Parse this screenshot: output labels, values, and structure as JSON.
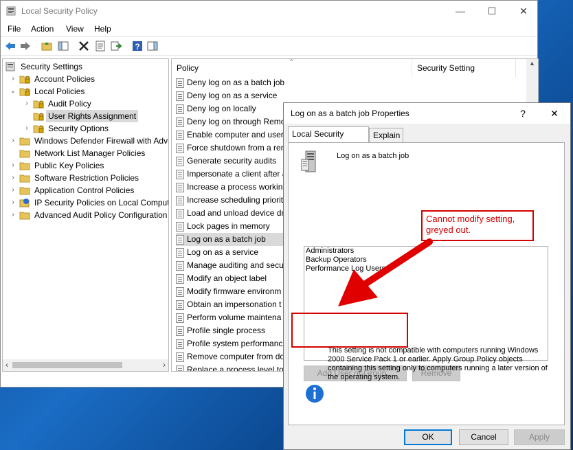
{
  "window": {
    "title": "Local Security Policy",
    "controls": {
      "minimize": "—",
      "maximize": "☐",
      "close": "✕"
    }
  },
  "menu": [
    "File",
    "Action",
    "View",
    "Help"
  ],
  "tree": [
    {
      "label": "Security Settings",
      "level": 0,
      "expander": "",
      "icon": "security-settings-icon"
    },
    {
      "label": "Account Policies",
      "level": 1,
      "expander": "›",
      "icon": "folder-lock-icon"
    },
    {
      "label": "Local Policies",
      "level": 1,
      "expander": "⌄",
      "icon": "folder-lock-icon"
    },
    {
      "label": "Audit Policy",
      "level": 2,
      "expander": "›",
      "icon": "folder-lock-icon"
    },
    {
      "label": "User Rights Assignment",
      "level": 2,
      "expander": "",
      "icon": "folder-lock-icon",
      "selected": true
    },
    {
      "label": "Security Options",
      "level": 2,
      "expander": "›",
      "icon": "folder-lock-icon"
    },
    {
      "label": "Windows Defender Firewall with Adva",
      "level": 1,
      "expander": "›",
      "icon": "folder-icon"
    },
    {
      "label": "Network List Manager Policies",
      "level": 1,
      "expander": "",
      "icon": "folder-icon"
    },
    {
      "label": "Public Key Policies",
      "level": 1,
      "expander": "›",
      "icon": "folder-icon"
    },
    {
      "label": "Software Restriction Policies",
      "level": 1,
      "expander": "›",
      "icon": "folder-icon"
    },
    {
      "label": "Application Control Policies",
      "level": 1,
      "expander": "›",
      "icon": "folder-icon"
    },
    {
      "label": "IP Security Policies on Local Compute",
      "level": 1,
      "expander": "›",
      "icon": "ip-security-icon"
    },
    {
      "label": "Advanced Audit Policy Configuration",
      "level": 1,
      "expander": "›",
      "icon": "folder-icon"
    }
  ],
  "policy_columns": {
    "policy": "Policy",
    "setting": "Security Setting"
  },
  "policies": [
    "Deny log on as a batch job",
    "Deny log on as a service",
    "Deny log on locally",
    "Deny log on through Remo",
    "Enable computer and user",
    "Force shutdown from a ren",
    "Generate security audits",
    "Impersonate a client after a",
    "Increase a process working",
    "Increase scheduling priority",
    "Load and unload device dr",
    "Lock pages in memory",
    "Log on as a batch job",
    "Log on as a service",
    "Manage auditing and secu",
    "Modify an object label",
    "Modify firmware environm",
    "Obtain an impersonation t",
    "Perform volume maintena",
    "Profile single process",
    "Profile system performanc",
    "Remove computer from do",
    "Replace a process level tok"
  ],
  "selected_policy_index": 12,
  "dialog": {
    "title": "Log on as a batch job Properties",
    "help": "?",
    "close": "✕",
    "tabs": [
      "Local Security Setting",
      "Explain"
    ],
    "policy_name": "Log on as a batch job",
    "members": [
      "Administrators",
      "Backup Operators",
      "Performance Log Users"
    ],
    "add_button": "Add User or Group...",
    "remove_button": "Remove",
    "info_text": "This setting is not compatible with computers running Windows 2000 Service Pack 1 or earlier.  Apply Group Policy objects containing this setting only to computers running a later version of the operating system.",
    "ok": "OK",
    "cancel": "Cancel",
    "apply": "Apply"
  },
  "annotation": {
    "text": "Cannot modify setting, greyed out.",
    "color": "#d40000"
  }
}
